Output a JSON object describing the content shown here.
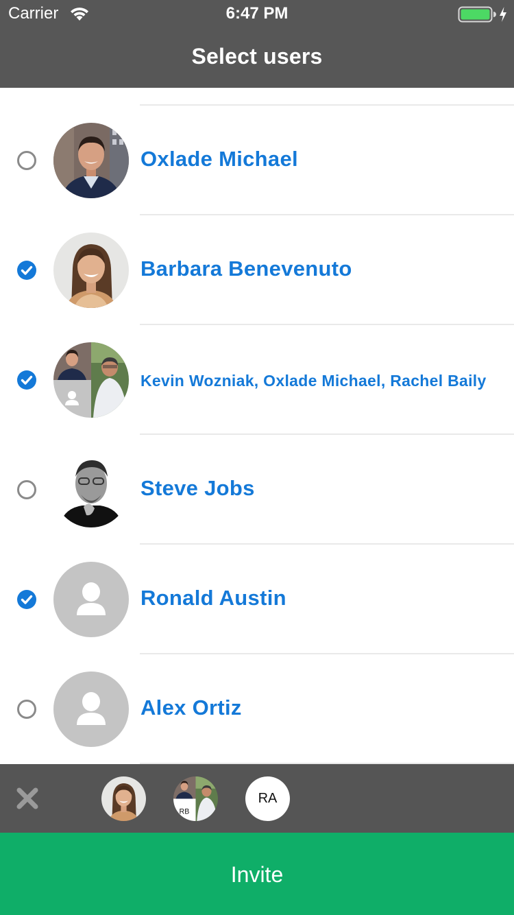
{
  "status_bar": {
    "carrier": "Carrier",
    "time": "6:47 PM",
    "battery_color": "#4cd964"
  },
  "header": {
    "title": "Select users",
    "background": "#575757"
  },
  "users": [
    {
      "name": "Oxlade Michael",
      "selected": false,
      "avatar": "photo-man-suit"
    },
    {
      "name": "Barbara Benevenuto",
      "selected": true,
      "avatar": "photo-woman"
    },
    {
      "name": "Kevin Wozniak, Oxlade Michael, Rachel Baily",
      "selected": true,
      "avatar": "group-collage"
    },
    {
      "name": "Steve Jobs",
      "selected": false,
      "avatar": "photo-bw-man"
    },
    {
      "name": "Ronald Austin",
      "selected": true,
      "avatar": "placeholder-person-icon"
    },
    {
      "name": "Alex Ortiz",
      "selected": false,
      "avatar": "placeholder-person-icon"
    }
  ],
  "selection_bar": {
    "clear_icon": "close-icon",
    "chips": [
      {
        "type": "photo",
        "avatar": "photo-woman"
      },
      {
        "type": "group",
        "initials": "RB"
      },
      {
        "type": "initials",
        "initials": "RA"
      }
    ]
  },
  "invite_button": {
    "label": "Invite",
    "color": "#0fae68"
  },
  "colors": {
    "accent": "#1479d8",
    "separator": "#e9e9e9"
  }
}
